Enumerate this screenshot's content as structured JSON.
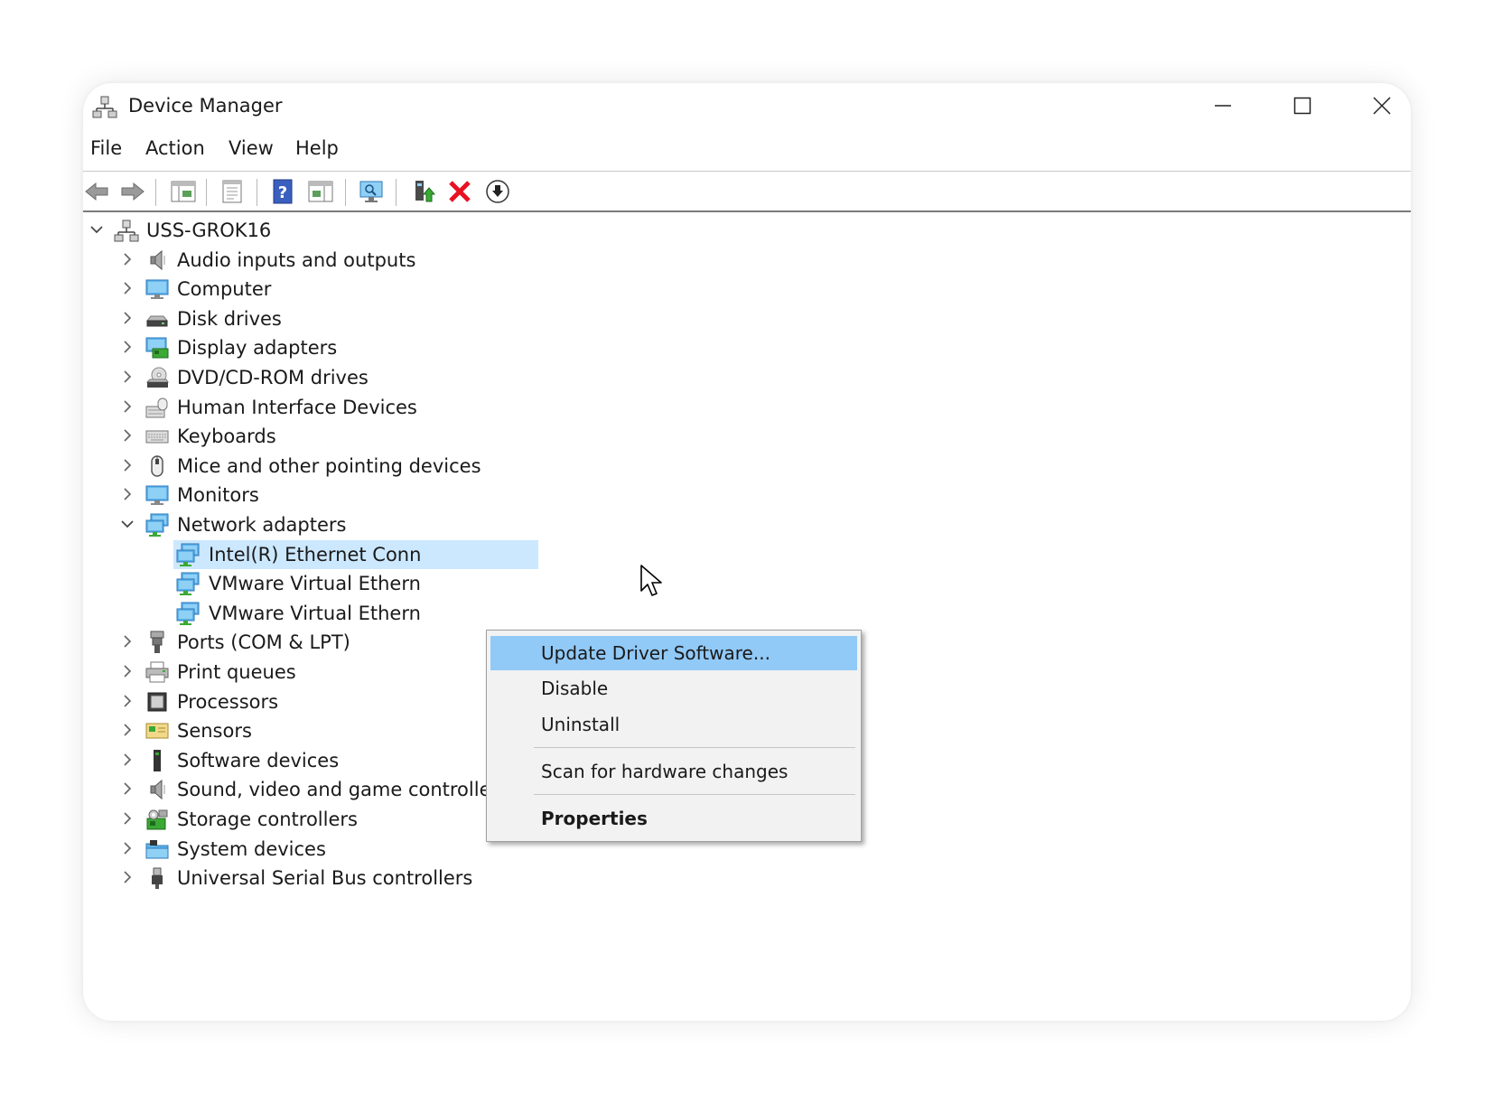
{
  "window": {
    "title": "Device Manager",
    "controls": {
      "minimize": "minimize",
      "maximize": "maximize",
      "close": "close"
    }
  },
  "menu": [
    "File",
    "Action",
    "View",
    "Help"
  ],
  "toolbar": {
    "icons": [
      "back-arrow-icon",
      "forward-arrow-icon",
      "show-hide-console-tree-icon",
      "properties-sheet-icon",
      "help-icon",
      "action-pane-icon",
      "scan-hardware-icon",
      "update-driver-icon",
      "uninstall-device-icon",
      "download-icon"
    ]
  },
  "tree": {
    "root": {
      "label": "USS-GROK16",
      "expanded": true
    },
    "categories": [
      {
        "label": "Audio inputs and outputs",
        "icon": "speaker-icon",
        "expanded": false
      },
      {
        "label": "Computer",
        "icon": "monitor-icon",
        "expanded": false
      },
      {
        "label": "Disk drives",
        "icon": "disk-drive-icon",
        "expanded": false
      },
      {
        "label": "Display adapters",
        "icon": "display-adapter-icon",
        "expanded": false
      },
      {
        "label": "DVD/CD-ROM drives",
        "icon": "dvd-drive-icon",
        "expanded": false
      },
      {
        "label": "Human Interface Devices",
        "icon": "hid-icon",
        "expanded": false
      },
      {
        "label": "Keyboards",
        "icon": "keyboard-icon",
        "expanded": false
      },
      {
        "label": "Mice and other pointing devices",
        "icon": "mouse-icon",
        "expanded": false
      },
      {
        "label": "Monitors",
        "icon": "monitor-icon",
        "expanded": false
      },
      {
        "label": "Network adapters",
        "icon": "network-adapter-icon",
        "expanded": true
      },
      {
        "label": "Ports (COM & LPT)",
        "icon": "port-icon",
        "expanded": false
      },
      {
        "label": "Print queues",
        "icon": "printer-icon",
        "expanded": false
      },
      {
        "label": "Processors",
        "icon": "processor-icon",
        "expanded": false
      },
      {
        "label": "Sensors",
        "icon": "sensor-icon",
        "expanded": false
      },
      {
        "label": "Software devices",
        "icon": "software-device-icon",
        "expanded": false
      },
      {
        "label": "Sound, video and game controllers",
        "icon": "speaker-icon",
        "expanded": false
      },
      {
        "label": "Storage controllers",
        "icon": "storage-controller-icon",
        "expanded": false
      },
      {
        "label": "System devices",
        "icon": "system-devices-icon",
        "expanded": false
      },
      {
        "label": "Universal Serial Bus controllers",
        "icon": "usb-icon",
        "expanded": false
      }
    ],
    "network_children": [
      {
        "label": "Intel(R) Ethernet Conn",
        "selected": true
      },
      {
        "label": "VMware Virtual Ethern",
        "selected": false
      },
      {
        "label": "VMware Virtual Ethern",
        "selected": false
      }
    ]
  },
  "context_menu": {
    "items": [
      {
        "label": "Update Driver Software...",
        "highlighted": true,
        "bold": false
      },
      {
        "label": "Disable",
        "highlighted": false,
        "bold": false
      },
      {
        "label": "Uninstall",
        "highlighted": false,
        "bold": false
      },
      {
        "label": "Scan for hardware changes",
        "highlighted": false,
        "bold": false
      },
      {
        "label": "Properties",
        "highlighted": false,
        "bold": true
      }
    ]
  },
  "colors": {
    "selection": "#cce8ff",
    "menu_highlight": "#91c9f7",
    "menu_background": "#f2f2f2",
    "uninstall_red": "#e81123",
    "network_green": "#3aa935",
    "monitor_blue": "#2e8fd8"
  }
}
